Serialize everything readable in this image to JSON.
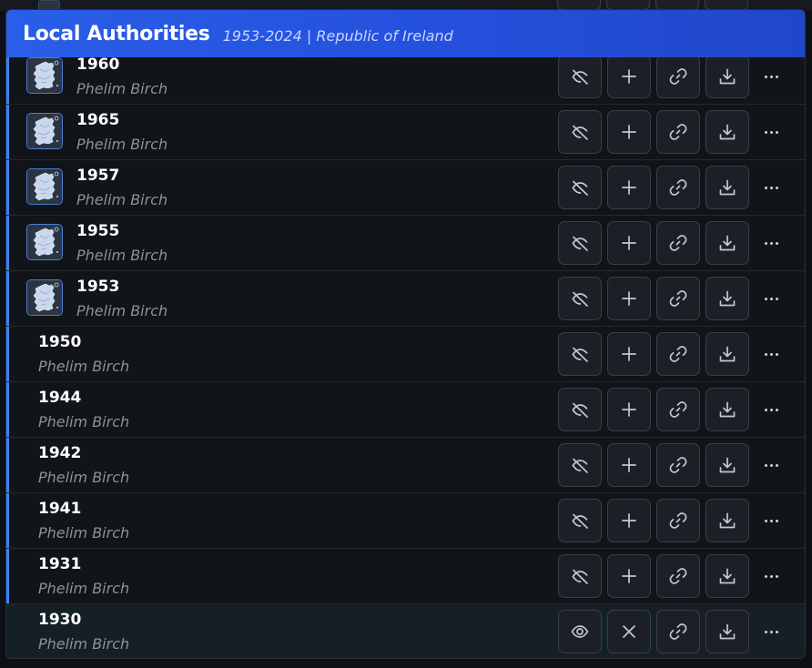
{
  "panel": {
    "title": "Local Authorities",
    "subtitle": "1953-2024 | Republic of Ireland"
  },
  "icons": {
    "hidden": "eye-off-icon",
    "visible": "eye-icon",
    "add": "plus-icon",
    "remove": "close-icon",
    "link": "link-icon",
    "download": "download-icon",
    "more": "more-horizontal-icon",
    "thumbnail": "ireland-map-thumbnail"
  },
  "colors": {
    "header_gradient_start": "#2a5ee8",
    "header_gradient_end": "#2047c9",
    "accent": "#3b82f6",
    "row_text": "#ffffff",
    "row_subtext": "#8b929b"
  },
  "rows": [
    {
      "year": "1960",
      "author": "Phelim Birch",
      "has_thumbnail": true,
      "visible": false,
      "in_map": false,
      "accent": true,
      "selected": false
    },
    {
      "year": "1965",
      "author": "Phelim Birch",
      "has_thumbnail": true,
      "visible": false,
      "in_map": false,
      "accent": true,
      "selected": false
    },
    {
      "year": "1957",
      "author": "Phelim Birch",
      "has_thumbnail": true,
      "visible": false,
      "in_map": false,
      "accent": true,
      "selected": false
    },
    {
      "year": "1955",
      "author": "Phelim Birch",
      "has_thumbnail": true,
      "visible": false,
      "in_map": false,
      "accent": true,
      "selected": false
    },
    {
      "year": "1953",
      "author": "Phelim Birch",
      "has_thumbnail": true,
      "visible": false,
      "in_map": false,
      "accent": true,
      "selected": false
    },
    {
      "year": "1950",
      "author": "Phelim Birch",
      "has_thumbnail": false,
      "visible": false,
      "in_map": false,
      "accent": true,
      "selected": false
    },
    {
      "year": "1944",
      "author": "Phelim Birch",
      "has_thumbnail": false,
      "visible": false,
      "in_map": false,
      "accent": true,
      "selected": false
    },
    {
      "year": "1942",
      "author": "Phelim Birch",
      "has_thumbnail": false,
      "visible": false,
      "in_map": false,
      "accent": true,
      "selected": false
    },
    {
      "year": "1941",
      "author": "Phelim Birch",
      "has_thumbnail": false,
      "visible": false,
      "in_map": false,
      "accent": true,
      "selected": false
    },
    {
      "year": "1931",
      "author": "Phelim Birch",
      "has_thumbnail": false,
      "visible": false,
      "in_map": false,
      "accent": true,
      "selected": false
    },
    {
      "year": "1930",
      "author": "Phelim Birch",
      "has_thumbnail": false,
      "visible": true,
      "in_map": true,
      "accent": false,
      "selected": true
    }
  ]
}
